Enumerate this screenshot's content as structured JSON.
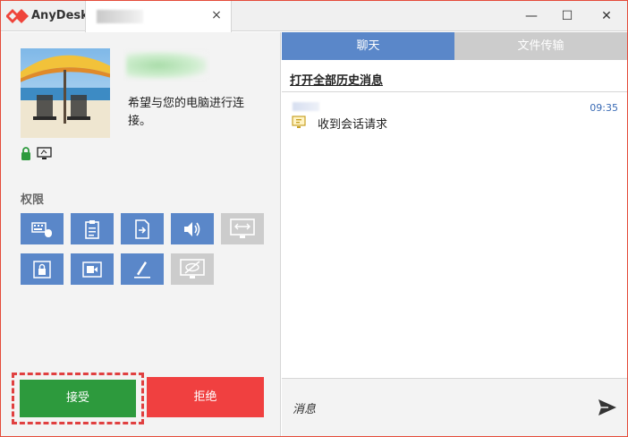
{
  "app": {
    "title": "AnyDesk"
  },
  "tab": {
    "close_label": "×"
  },
  "window_controls": {
    "minimize": "—",
    "maximize": "☐",
    "close": "✕"
  },
  "request": {
    "text": "希望与您的电脑进行连接。"
  },
  "permissions": {
    "label": "权限",
    "items": [
      {
        "name": "keyboard-mouse",
        "enabled": true
      },
      {
        "name": "clipboard",
        "enabled": true
      },
      {
        "name": "file-manager",
        "enabled": true
      },
      {
        "name": "sound",
        "enabled": true
      },
      {
        "name": "switch-sides",
        "enabled": false
      },
      {
        "name": "lock-account",
        "enabled": true
      },
      {
        "name": "record-session",
        "enabled": true
      },
      {
        "name": "draw",
        "enabled": true
      },
      {
        "name": "privacy-mode",
        "enabled": false
      }
    ]
  },
  "actions": {
    "accept": "接受",
    "reject": "拒绝"
  },
  "chat": {
    "tabs": [
      "聊天",
      "文件传输"
    ],
    "history_link": "打开全部历史消息",
    "messages": [
      {
        "time": "09:35",
        "text": "收到会话请求"
      }
    ],
    "input_placeholder": "消息"
  },
  "colors": {
    "accent": "#5a87c9",
    "accept": "#2d9a3d",
    "reject": "#f04040",
    "brand": "#ef443b"
  }
}
